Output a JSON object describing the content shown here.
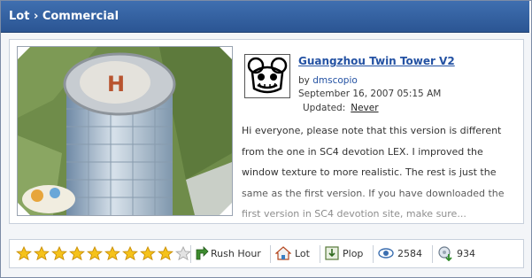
{
  "header": {
    "breadcrumb": "Lot › Commercial"
  },
  "item": {
    "title": "Guangzhou Twin Tower V2",
    "by_prefix": "by",
    "author": "dmscopio",
    "date": "September 16, 2007 05:15 AM",
    "updated_label": "Updated:",
    "updated_value": "Never",
    "description": "Hi everyone, please note that this version is different from the one in SC4 devotion LEX. I improved the window texture to more realistic. The rest is just the same as the first version. If you have downloaded the first version in SC4 devotion site, make sure..."
  },
  "footer": {
    "rating": {
      "value": 9,
      "max": 10
    },
    "category1": "Rush Hour",
    "category2": "Lot",
    "category3": "Plop",
    "views": "2584",
    "downloads": "934"
  },
  "colors": {
    "header": "#2f5c9e",
    "link": "#2452a3",
    "star": "#f5c21a"
  },
  "icons": [
    "rush-hour-icon",
    "lot-house-icon",
    "plop-icon",
    "views-eye-icon",
    "downloads-icon"
  ]
}
